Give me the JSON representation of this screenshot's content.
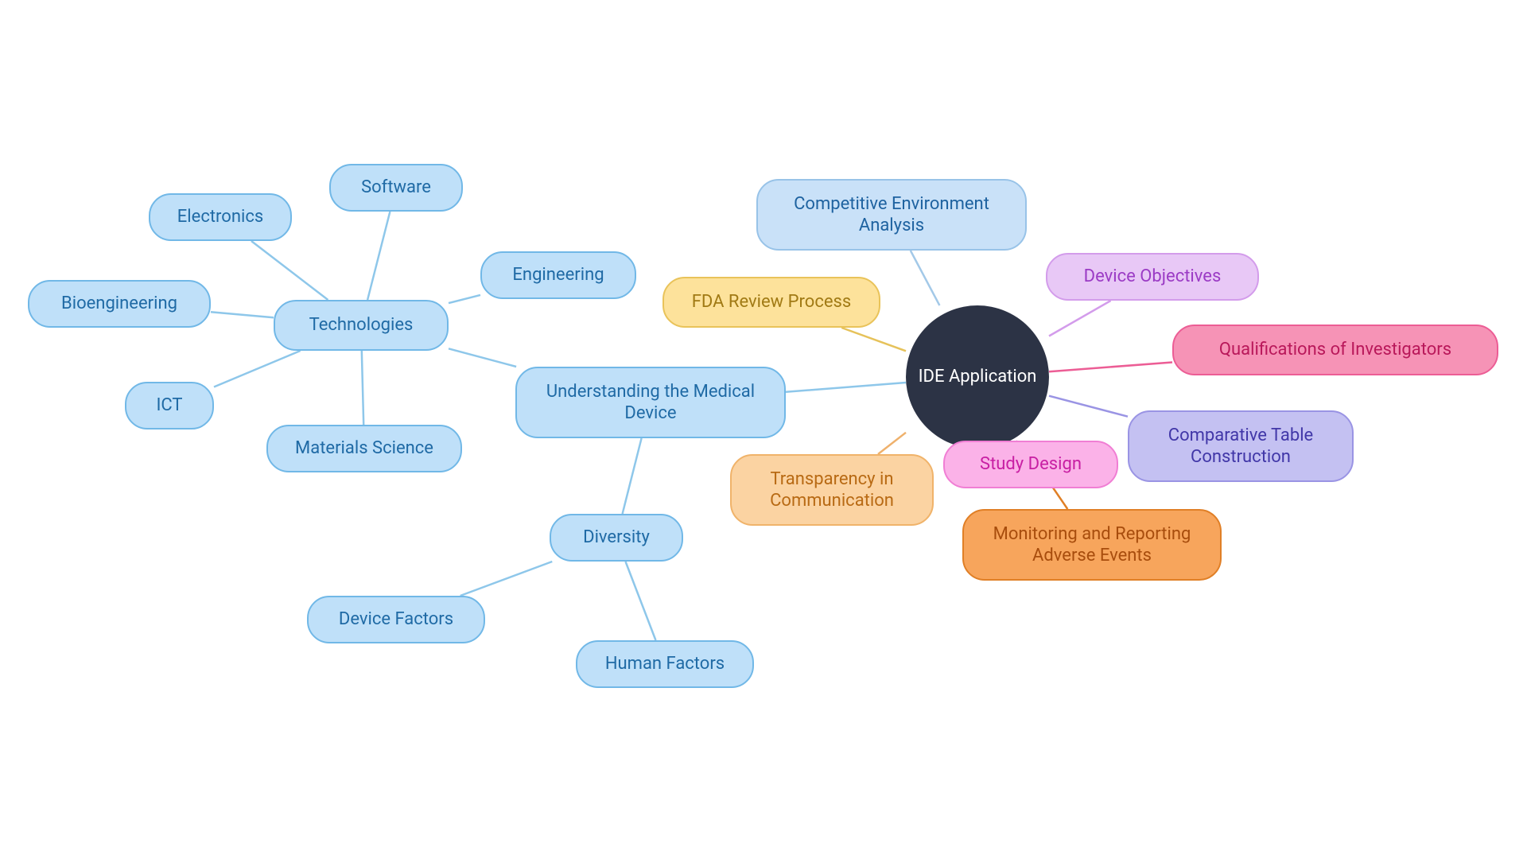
{
  "center": {
    "label": "IDE Application"
  },
  "nodes": {
    "understanding": {
      "label": "Understanding the Medical\nDevice"
    },
    "technologies": {
      "label": "Technologies"
    },
    "electronics": {
      "label": "Electronics"
    },
    "software": {
      "label": "Software"
    },
    "engineering": {
      "label": "Engineering"
    },
    "bioengineering": {
      "label": "Bioengineering"
    },
    "ict": {
      "label": "ICT"
    },
    "materials": {
      "label": "Materials Science"
    },
    "diversity": {
      "label": "Diversity"
    },
    "device_factors": {
      "label": "Device Factors"
    },
    "human_factors": {
      "label": "Human Factors"
    },
    "competitive": {
      "label": "Competitive Environment\nAnalysis"
    },
    "fda": {
      "label": "FDA Review Process"
    },
    "transparency": {
      "label": "Transparency in\nCommunication"
    },
    "study_design": {
      "label": "Study Design"
    },
    "monitoring": {
      "label": "Monitoring and Reporting\nAdverse Events"
    },
    "comparative": {
      "label": "Comparative Table\nConstruction"
    },
    "qualifications": {
      "label": "Qualifications of Investigators"
    },
    "objectives": {
      "label": "Device Objectives"
    }
  },
  "edges": [
    {
      "from": "center",
      "to": "understanding",
      "color": "#8ec7ea"
    },
    {
      "from": "center",
      "to": "competitive",
      "color": "#a3c9e8"
    },
    {
      "from": "center",
      "to": "fda",
      "color": "#e6c25a"
    },
    {
      "from": "center",
      "to": "transparency",
      "color": "#efb16c"
    },
    {
      "from": "center",
      "to": "study_design",
      "color": "#f07ed4"
    },
    {
      "from": "center",
      "to": "monitoring",
      "color": "#e07f26"
    },
    {
      "from": "center",
      "to": "comparative",
      "color": "#9a94e4"
    },
    {
      "from": "center",
      "to": "qualifications",
      "color": "#ec5d95"
    },
    {
      "from": "center",
      "to": "objectives",
      "color": "#d39ceb"
    },
    {
      "from": "understanding",
      "to": "technologies",
      "color": "#8ec7ea"
    },
    {
      "from": "understanding",
      "to": "diversity",
      "color": "#8ec7ea"
    },
    {
      "from": "technologies",
      "to": "electronics",
      "color": "#8ec7ea"
    },
    {
      "from": "technologies",
      "to": "software",
      "color": "#8ec7ea"
    },
    {
      "from": "technologies",
      "to": "engineering",
      "color": "#8ec7ea"
    },
    {
      "from": "technologies",
      "to": "bioengineering",
      "color": "#8ec7ea"
    },
    {
      "from": "technologies",
      "to": "ict",
      "color": "#8ec7ea"
    },
    {
      "from": "technologies",
      "to": "materials",
      "color": "#8ec7ea"
    },
    {
      "from": "diversity",
      "to": "device_factors",
      "color": "#8ec7ea"
    },
    {
      "from": "diversity",
      "to": "human_factors",
      "color": "#8ec7ea"
    }
  ]
}
